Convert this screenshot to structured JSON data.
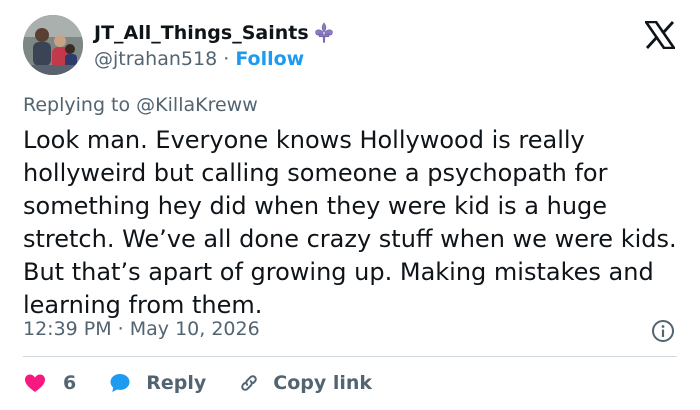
{
  "user": {
    "display_name": "JT_All_Things_Saints",
    "handle": "@jtrahan518",
    "separator": "·",
    "follow_label": "Follow"
  },
  "replying": {
    "prefix": "Replying to",
    "mention": "@KillaKreww"
  },
  "tweet": {
    "text": "Look man. Everyone knows Hollywood is really hollyweird but calling someone a psychopath for something hey did when they were kid is a huge stretch. We’ve all done crazy stuff when we were kids. But that’s apart of growing up. Making mistakes and learning from them.",
    "timestamp": "12:39 PM · May 10, 2026"
  },
  "actions": {
    "like_count": "6",
    "reply_label": "Reply",
    "copy_label": "Copy link"
  },
  "icons": {
    "logo": "x-logo-icon",
    "verified_emblem": "fleur-de-lis-icon",
    "info": "info-icon",
    "like": "heart-icon",
    "reply": "speech-bubble-icon",
    "copy": "link-icon"
  },
  "colors": {
    "text": "#0f1419",
    "muted": "#536471",
    "accent": "#1d9bf0",
    "like": "#f91880",
    "fleur": "#8e7cc3",
    "divider": "#cfd9de"
  }
}
